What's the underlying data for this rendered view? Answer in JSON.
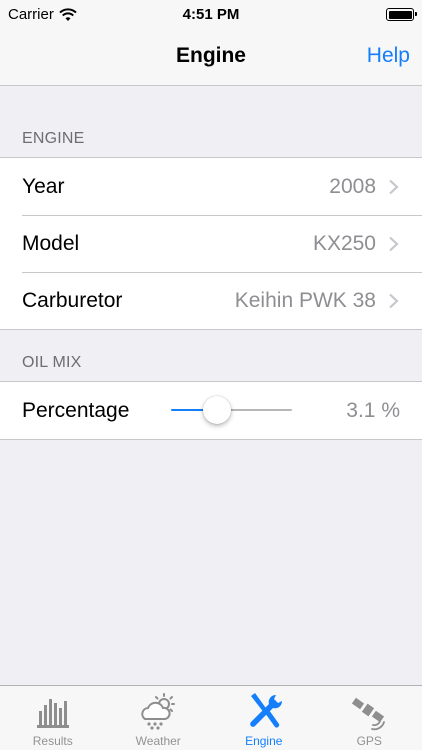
{
  "status_bar": {
    "carrier": "Carrier",
    "time": "4:51 PM"
  },
  "nav": {
    "title": "Engine",
    "help_label": "Help"
  },
  "sections": {
    "engine": {
      "header": "ENGINE",
      "rows": [
        {
          "label": "Year",
          "value": "2008"
        },
        {
          "label": "Model",
          "value": "KX250"
        },
        {
          "label": "Carburetor",
          "value": "Keihin PWK 38"
        }
      ]
    },
    "oil_mix": {
      "header": "OIL MIX",
      "percentage_label": "Percentage",
      "percentage_value": "3.1 %",
      "slider_fraction": 0.34
    }
  },
  "tabs": [
    {
      "label": "Results",
      "icon": "bar-chart-icon",
      "active": false
    },
    {
      "label": "Weather",
      "icon": "weather-cloud-sun-icon",
      "active": false
    },
    {
      "label": "Engine",
      "icon": "wrench-screwdriver-icon",
      "active": true
    },
    {
      "label": "GPS",
      "icon": "satellite-icon",
      "active": false
    }
  ],
  "colors": {
    "accent": "#157efb",
    "background": "#efeff4",
    "secondary_text": "#8e8e93"
  }
}
